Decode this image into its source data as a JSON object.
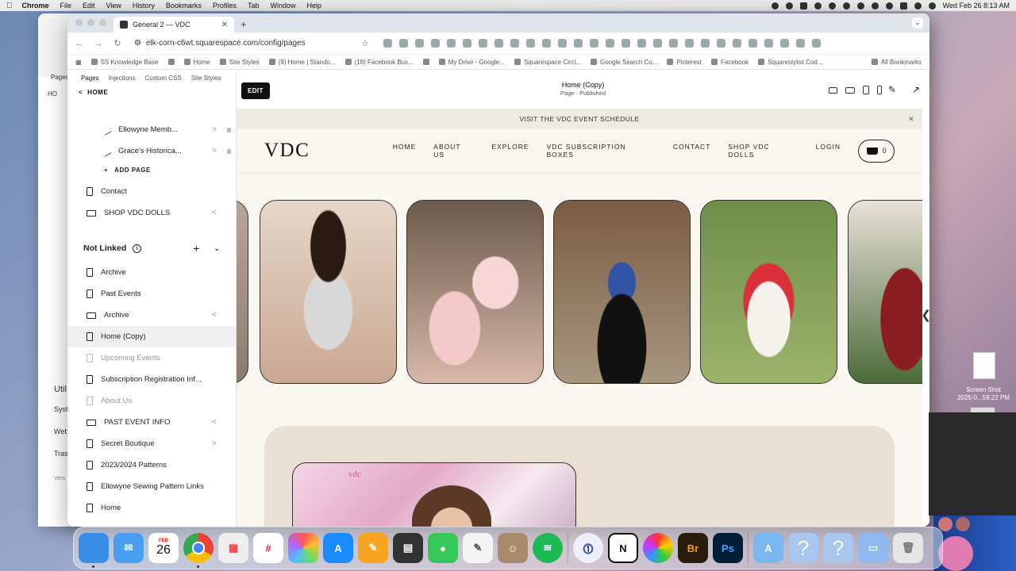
{
  "menubar": {
    "app": "Chrome",
    "items": [
      "File",
      "Edit",
      "View",
      "History",
      "Bookmarks",
      "Profiles",
      "Tab",
      "Window",
      "Help"
    ],
    "datetime": "Wed Feb 26  8:13 AM"
  },
  "browser": {
    "tab_title": "General 2 — VDC",
    "url": "elk-corn-c6wt.squarespace.com/config/pages",
    "bookmarks": [
      "SS Knowledge Base",
      "Home",
      "Site Styles",
      "(9) Home | Stando...",
      "(18) Facebook Bus...",
      "My Drive - Google...",
      "Squarespace Circl...",
      "Google Search Co...",
      "Pinterest",
      "Facebook",
      "Squarestylist Cod..."
    ],
    "all_bookmarks": "All Bookmarks"
  },
  "background_window": {
    "tab_label": "Pages",
    "items": [
      "Util",
      "Syst",
      "Web",
      "Tras",
      "Vers"
    ],
    "home": "HO"
  },
  "panel": {
    "tabs": [
      "Pages",
      "Injections",
      "Custom CSS",
      "Site Styles"
    ],
    "back_label": "HOME",
    "linked_items": [
      {
        "label": "Ellowyne Memb...",
        "type": "link",
        "sub": true,
        "chev": ">"
      },
      {
        "label": "Grace's Historica...",
        "type": "link",
        "sub": true,
        "chev": ">"
      }
    ],
    "add_page": "ADD PAGE",
    "top_items": [
      {
        "label": "Contact",
        "type": "page"
      },
      {
        "label": "SHOP VDC DOLLS",
        "type": "folder",
        "chev": "<"
      }
    ],
    "not_linked_title": "Not Linked",
    "not_linked": [
      {
        "label": "Archive",
        "type": "page",
        "state": ""
      },
      {
        "label": "Past Events",
        "type": "page",
        "state": ""
      },
      {
        "label": "Archive",
        "type": "folder",
        "state": "",
        "chev": "<"
      },
      {
        "label": "Home (Copy)",
        "type": "page",
        "state": "sel"
      },
      {
        "label": "Upcoming Events",
        "type": "page",
        "state": "dim"
      },
      {
        "label": "Subscription Registration Inf...",
        "type": "page",
        "state": ""
      },
      {
        "label": "About Us",
        "type": "page",
        "state": "dim"
      },
      {
        "label": "PAST EVENT INFO",
        "type": "folder",
        "state": "",
        "chev": "<"
      },
      {
        "label": "Secret Boutique",
        "type": "page",
        "state": "",
        "chev": ">"
      },
      {
        "label": "2023/2024 Patterns",
        "type": "page",
        "state": ""
      },
      {
        "label": "Ellowyne Sewing Pattern Links",
        "type": "page",
        "state": ""
      },
      {
        "label": "Home",
        "type": "page",
        "state": ""
      }
    ]
  },
  "preview": {
    "edit_label": "EDIT",
    "page_title": "Home (Copy)",
    "page_status": "Page · Published",
    "announcement": "VISIT THE VDC EVENT SCHEDULE",
    "logo": "VDC",
    "nav": [
      "HOME",
      "ABOUT US",
      "EXPLORE",
      "VDC SUBSCRIPTION BOXES",
      "CONTACT",
      "SHOP VDC DOLLS",
      "LOGIN"
    ],
    "cart_count": "0",
    "inner_logo": "vdc"
  },
  "desktop": {
    "screenshot_label_1": "Screen Shot",
    "screenshot_label_2": "2025-0...59.22 PM"
  },
  "dock": {
    "calendar_month": "FEB",
    "calendar_day": "26"
  }
}
